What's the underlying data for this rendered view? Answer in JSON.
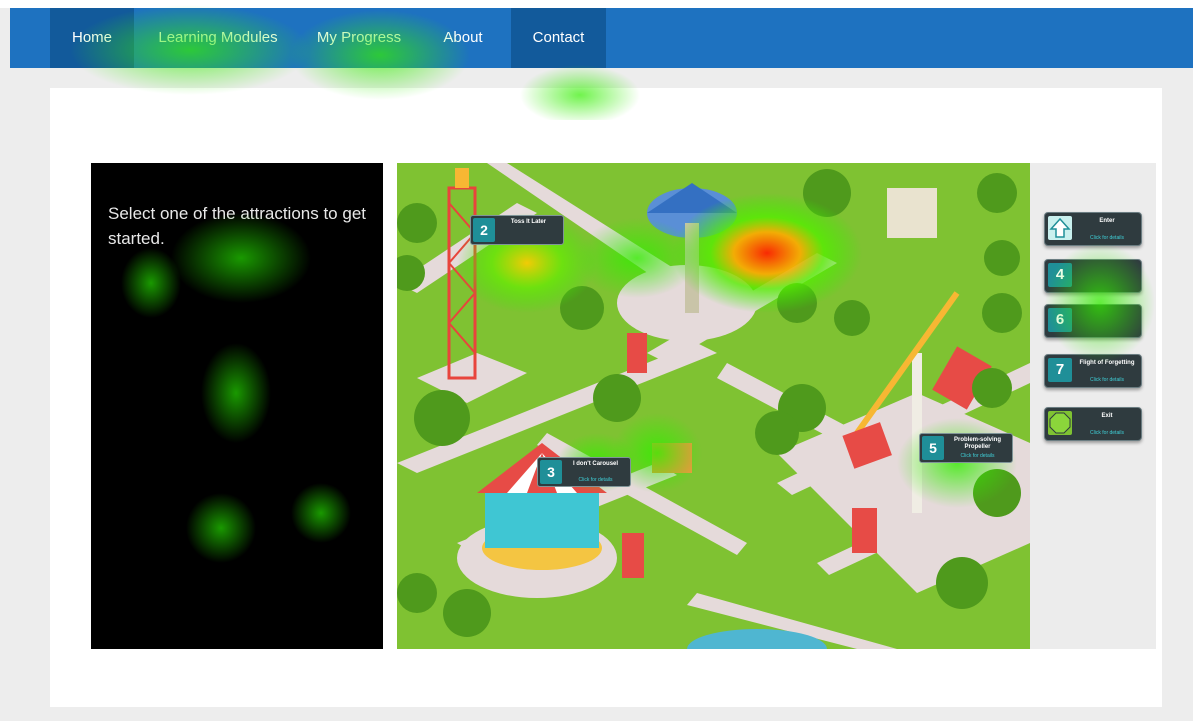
{
  "nav": {
    "items": [
      {
        "label": "Home"
      },
      {
        "label": "Learning Modules"
      },
      {
        "label": "My Progress"
      },
      {
        "label": "About"
      },
      {
        "label": "Contact"
      }
    ]
  },
  "left_panel": {
    "prompt": "Select one of the attractions to get started."
  },
  "map": {
    "attractions": [
      {
        "number": "2",
        "label": "Toss It Later",
        "sub": ""
      },
      {
        "number": "3",
        "label": "I don't Carousel",
        "sub": "Click for details"
      },
      {
        "number": "5",
        "label": "Problem-solving Propeller",
        "sub": "Click for details"
      }
    ]
  },
  "side_menu": {
    "enter": {
      "label": "Enter",
      "sub": "Click for details"
    },
    "items": [
      {
        "number": "4",
        "label": "",
        "sub": ""
      },
      {
        "number": "6",
        "label": "",
        "sub": ""
      },
      {
        "number": "7",
        "label": "Flight of Forgetting",
        "sub": "Click for details"
      }
    ],
    "exit": {
      "label": "Exit",
      "sub": "Click for details"
    }
  },
  "colors": {
    "nav_bg": "#1e72c0",
    "nav_active": "#125a9b",
    "grass": "#7fc232",
    "path": "#e5dada",
    "button_bg": "#2f3b3f",
    "teal": "#1f8f98",
    "heat_green": "#33ee00",
    "heat_hot": "#ff2200"
  }
}
